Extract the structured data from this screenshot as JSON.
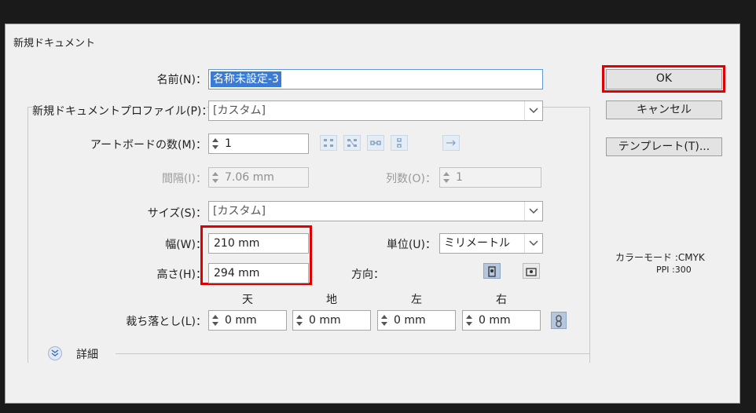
{
  "dialog": {
    "title": "新規ドキュメント"
  },
  "name_row": {
    "label": "名前(N)：",
    "value": "名称未設定-3"
  },
  "profile_row": {
    "label": "新規ドキュメントプロファイル(P)：",
    "value": "[カスタム]"
  },
  "artboards_row": {
    "label": "アートボードの数(M)：",
    "value": "1"
  },
  "spacing_row": {
    "label": "間隔(I)：",
    "value": "7.06 mm"
  },
  "columns_row": {
    "label": "列数(O)：",
    "value": "1"
  },
  "size_row": {
    "label": "サイズ(S)：",
    "value": "[カスタム]"
  },
  "width_row": {
    "label": "幅(W)：",
    "value": "210 mm"
  },
  "height_row": {
    "label": "高さ(H)：",
    "value": "294 mm"
  },
  "units_row": {
    "label": "単位(U)：",
    "value": "ミリメートル"
  },
  "orientation_row": {
    "label": "方向："
  },
  "bleed": {
    "label": "裁ち落とし(L)：",
    "headers": [
      "天",
      "地",
      "左",
      "右"
    ],
    "values": [
      "0 mm",
      "0 mm",
      "0 mm",
      "0 mm"
    ]
  },
  "details": {
    "label": "詳細"
  },
  "buttons": {
    "ok": "OK",
    "cancel": "キャンセル",
    "templates": "テンプレート(T)..."
  },
  "info": {
    "color_mode": "カラーモード :CMYK",
    "ppi": "PPI :300"
  },
  "colors": {
    "highlight_red": "#e00000",
    "selection_blue": "#3b7bd4"
  },
  "icons": [
    "grid-by-row-icon",
    "grid-by-column-icon",
    "arrange-by-row-icon",
    "arrange-by-column-icon",
    "right-to-left-icon",
    "portrait-icon",
    "landscape-icon",
    "link-icon",
    "chevron-down-icon",
    "expand-details-icon",
    "spinner-icon"
  ]
}
